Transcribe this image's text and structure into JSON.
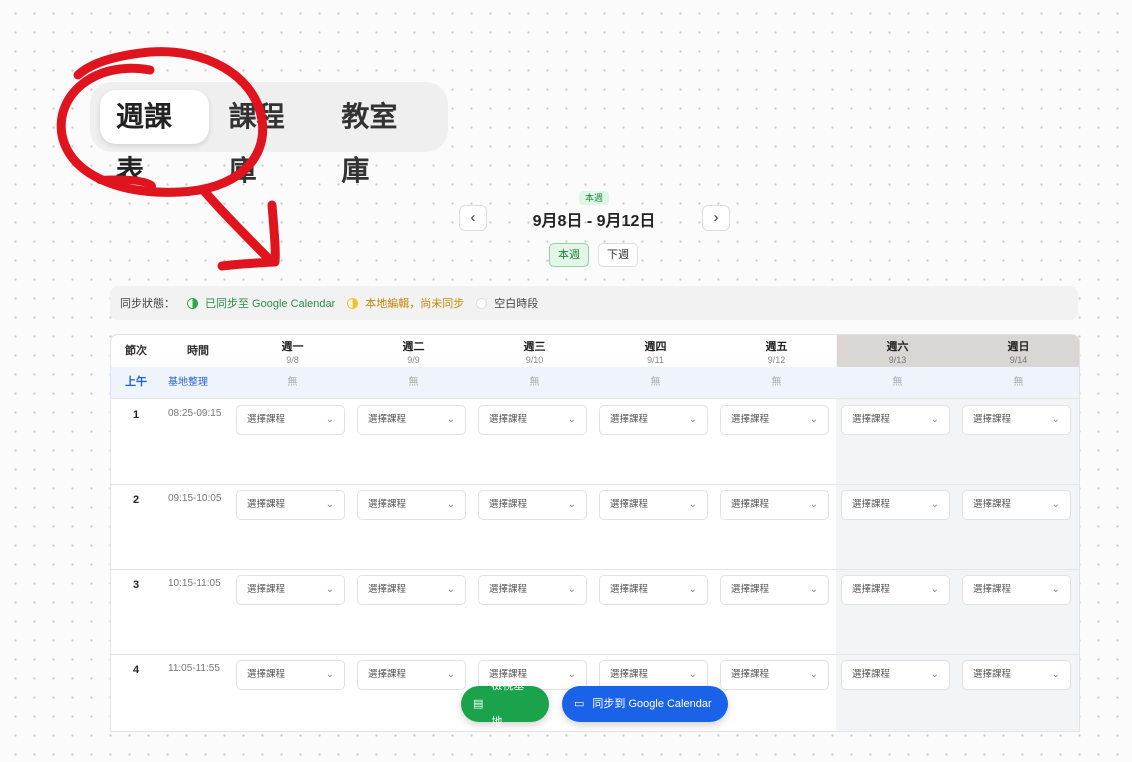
{
  "tabs": [
    {
      "label": "週課表",
      "active": true
    },
    {
      "label": "課程庫",
      "active": false
    },
    {
      "label": "教室庫",
      "active": false
    }
  ],
  "week_nav": {
    "badge": "本週",
    "range": "9月8日 - 9月12日",
    "prev_icon": "‹",
    "next_icon": "›",
    "this_week_label": "本週",
    "next_week_label": "下週"
  },
  "legend": {
    "label": "同步狀態：",
    "synced": "已同步至 Google Calendar",
    "local": "本地編輯，尚未同步",
    "empty": "空白時段"
  },
  "table": {
    "period_header": "節次",
    "time_header": "時間",
    "days": [
      {
        "name": "週一",
        "date": "9/8",
        "weekend": false
      },
      {
        "name": "週二",
        "date": "9/9",
        "weekend": false
      },
      {
        "name": "週三",
        "date": "9/10",
        "weekend": false
      },
      {
        "name": "週四",
        "date": "9/11",
        "weekend": false
      },
      {
        "name": "週五",
        "date": "9/12",
        "weekend": false
      },
      {
        "name": "週六",
        "date": "9/13",
        "weekend": true
      },
      {
        "name": "週日",
        "date": "9/14",
        "weekend": true
      }
    ],
    "morning_label": "上午",
    "morning_activity": "基地整理",
    "none_label": "無",
    "select_placeholder": "選擇課程",
    "periods": [
      {
        "no": "1",
        "time": "08:25-09:15"
      },
      {
        "no": "2",
        "time": "09:15-10:05"
      },
      {
        "no": "3",
        "time": "10:15-11:05"
      },
      {
        "no": "4",
        "time": "11:05-11:55"
      }
    ]
  },
  "actions": {
    "view_base": "檢視基地",
    "sync_google": "同步到 Google Calendar"
  },
  "colors": {
    "annotation": "#e0141e",
    "green": "#1aa34a",
    "blue": "#1a63e8"
  }
}
